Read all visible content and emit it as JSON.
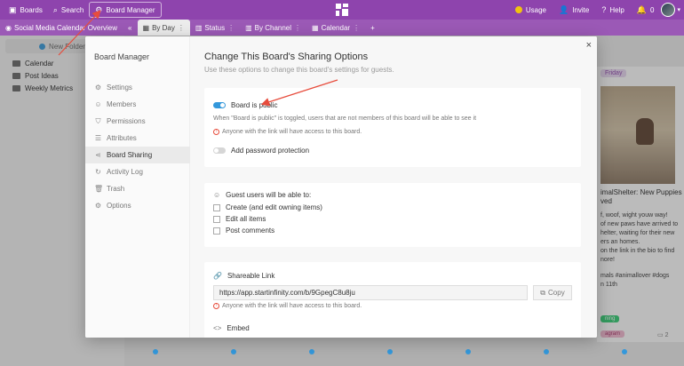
{
  "topbar": {
    "boards": "Boards",
    "search": "Search",
    "board_manager": "Board Manager",
    "usage": "Usage",
    "invite": "Invite",
    "help": "Help",
    "notifications_count": "0"
  },
  "tabs": {
    "workspace": "Social Media Calendar Overview",
    "items": [
      "By Day",
      "Status",
      "By Channel",
      "Calendar"
    ]
  },
  "sidebar": {
    "new_folder": "New Folder",
    "folders": [
      "Calendar",
      "Post Ideas",
      "Weekly Metrics"
    ]
  },
  "background_card": {
    "day_chip": "Friday",
    "line1": "imalShelter: New Puppies",
    "line2": "ved",
    "line3": "f, woof, wight youw way!",
    "line4": "of new paws have arrived to",
    "line5": "helter, waiting for their new",
    "line6": "ers an homes.",
    "line7": "on the link in the bio to find",
    "line8": "nore!",
    "line9": "mals #animallover #dogs",
    "line10": "n 11th",
    "tag1": "ning",
    "tag2": "agram",
    "comments": "2"
  },
  "modal": {
    "sidebar_title": "Board Manager",
    "nav": [
      "Settings",
      "Members",
      "Permissions",
      "Attributes",
      "Board Sharing",
      "Activity Log",
      "Trash",
      "Options"
    ],
    "title": "Change This Board's Sharing Options",
    "subtitle": "Use these options to change this board's settings for guests.",
    "public_label": "Board is public",
    "public_desc": "When \"Board is public\" is toggled, users that are not members of this board will be able to see it",
    "public_warning": "Anyone with the link will have access to this board.",
    "password_label": "Add password protection",
    "guest_heading": "Guest users will be able to:",
    "guest_options": [
      "Create (and edit owning items)",
      "Edit all items",
      "Post comments"
    ],
    "shareable_heading": "Shareable Link",
    "shareable_link": "https://app.startinfinity.com/b/9GpegC8u8ju",
    "copy_label": "Copy",
    "link_warning": "Anyone with the link will have access to this board.",
    "embed_label": "Embed",
    "close": "×"
  },
  "colors": {
    "topbar": "#8e44ad",
    "accent": "#3498db",
    "annotation": "#e74c3c"
  },
  "icons": {
    "boards": "boards-icon",
    "search": "search-icon",
    "board_manager": "gear-icon",
    "help": "help-icon",
    "bell": "bell-icon",
    "close": "close-icon"
  }
}
